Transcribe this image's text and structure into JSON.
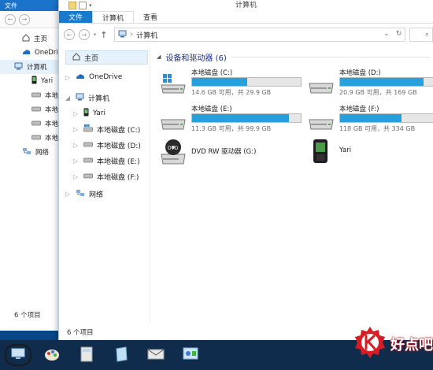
{
  "back_window": {
    "menu_label": "文件",
    "tree": [
      {
        "label": "主页",
        "icon": "home-icon"
      },
      {
        "label": "OneDrive",
        "icon": "onedrive-icon"
      },
      {
        "label": "计算机",
        "icon": "computer-icon"
      },
      {
        "label": "Yari",
        "icon": "phone-icon"
      },
      {
        "label": "本地",
        "icon": "drive-icon"
      },
      {
        "label": "本地",
        "icon": "drive-icon"
      },
      {
        "label": "本地",
        "icon": "drive-icon"
      },
      {
        "label": "本地",
        "icon": "drive-icon"
      },
      {
        "label": "网络",
        "icon": "network-icon"
      }
    ],
    "status": "6 个项目"
  },
  "window": {
    "title": "计算机",
    "ribbon_tabs": [
      "文件",
      "计算机",
      "查看"
    ],
    "address_path": "计算机",
    "nav": {
      "back": "←",
      "forward": "→",
      "up": "↑"
    },
    "sidebar": {
      "home": "主页",
      "items": [
        {
          "label": "OneDrive",
          "icon": "onedrive-icon",
          "expander": "▷"
        },
        {
          "label": "计算机",
          "icon": "computer-icon",
          "expander": "◢"
        },
        {
          "label": "Yari",
          "icon": "phone-icon",
          "expander": "▷"
        },
        {
          "label": "本地磁盘 (C:)",
          "icon": "drive-icon",
          "expander": "▷"
        },
        {
          "label": "本地磁盘 (D:)",
          "icon": "drive-icon",
          "expander": "▷"
        },
        {
          "label": "本地磁盘 (E:)",
          "icon": "drive-icon",
          "expander": "▷"
        },
        {
          "label": "本地磁盘 (F:)",
          "icon": "drive-icon",
          "expander": "▷"
        },
        {
          "label": "网络",
          "icon": "network-icon",
          "expander": "▷"
        }
      ]
    },
    "group_header": "设备和驱动器 (6)",
    "drives": [
      {
        "name": "本地磁盘 (C:)",
        "size": "14.6 GB 可用，共 29.9 GB",
        "used_fraction": 0.51,
        "icon": "windows-drive-icon"
      },
      {
        "name": "本地磁盘 (D:)",
        "size": "20.9 GB 可用，共 169 GB",
        "used_fraction": 0.88,
        "icon": "drive-icon"
      },
      {
        "name": "本地磁盘 (E:)",
        "size": "11.3 GB 可用，共 99.9 GB",
        "used_fraction": 0.89,
        "icon": "drive-icon"
      },
      {
        "name": "本地磁盘 (F:)",
        "size": "118 GB 可用，共 334 GB",
        "used_fraction": 0.65,
        "icon": "drive-icon"
      }
    ],
    "devices": [
      {
        "name": "DVD RW 驱动器 (G:)",
        "icon": "dvd-drive-icon"
      },
      {
        "name": "Yari",
        "icon": "phone-icon"
      }
    ],
    "status": "6 个项目"
  },
  "taskbar": {
    "items": [
      "computer-icon",
      "paint-icon",
      "calculator-icon",
      "notepad-icon",
      "mail-icon",
      "control-panel-icon"
    ]
  },
  "watermark": {
    "text": "好点吧",
    "logo": "gear-k-logo"
  },
  "colors": {
    "accent": "#1979ca",
    "bar_fill": "#26a0da",
    "group_header": "#1e3287",
    "taskbar": "#0f2c4d"
  }
}
